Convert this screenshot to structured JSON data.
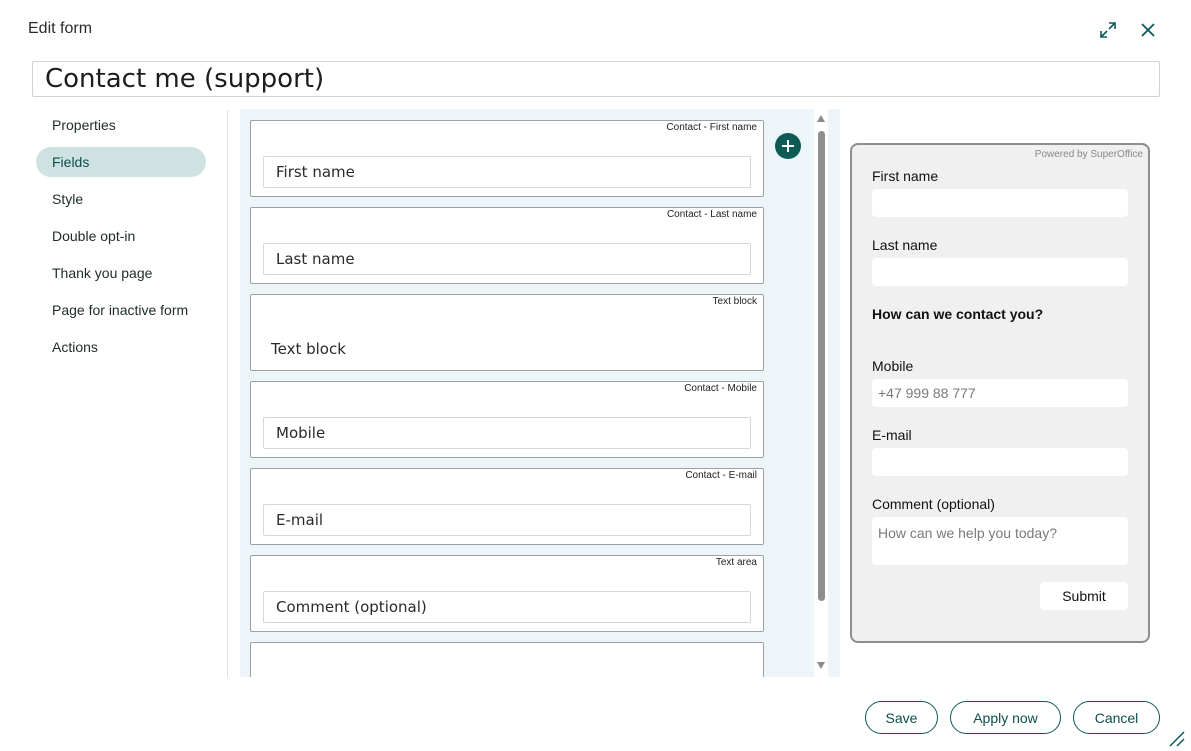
{
  "dialog": {
    "title": "Edit form",
    "form_name": "Contact me (support)"
  },
  "nav": {
    "items": [
      {
        "label": "Properties"
      },
      {
        "label": "Fields"
      },
      {
        "label": "Style"
      },
      {
        "label": "Double opt-in"
      },
      {
        "label": "Thank you page"
      },
      {
        "label": "Page for inactive form"
      },
      {
        "label": "Actions"
      }
    ],
    "active": "Fields"
  },
  "fields": [
    {
      "type": "Contact - First name",
      "label": "First name"
    },
    {
      "type": "Contact - Last name",
      "label": "Last name"
    },
    {
      "type": "Text block",
      "label": "Text block"
    },
    {
      "type": "Contact - Mobile",
      "label": "Mobile"
    },
    {
      "type": "Contact - E-mail",
      "label": "E-mail"
    },
    {
      "type": "Text area",
      "label": "Comment (optional)"
    }
  ],
  "preview": {
    "powered_by": "Powered by SuperOffice",
    "first_name_label": "First name",
    "last_name_label": "Last name",
    "heading": "How can we contact you?",
    "mobile_label": "Mobile",
    "mobile_placeholder": "+47 999 88 777",
    "email_label": "E-mail",
    "comment_label": "Comment (optional)",
    "comment_placeholder": "How can we help you today?",
    "submit_label": "Submit"
  },
  "footer": {
    "save": "Save",
    "apply": "Apply now",
    "cancel": "Cancel"
  },
  "colors": {
    "accent": "#0d5a56",
    "active_nav": "#cfe2e2",
    "panel_bg": "#eef5f8"
  },
  "icons": [
    "expand-icon",
    "close-icon",
    "plus-icon",
    "resize-grip-icon"
  ]
}
